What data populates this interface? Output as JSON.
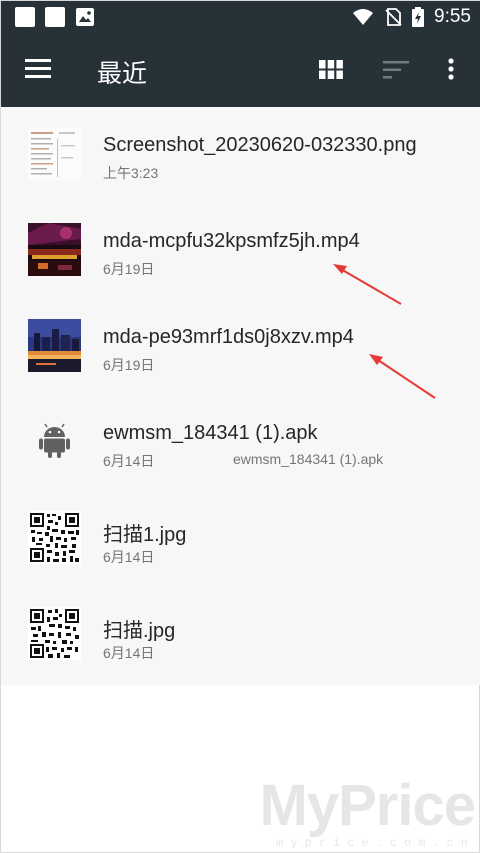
{
  "status_bar": {
    "time": "9:55"
  },
  "toolbar": {
    "title": "最近"
  },
  "files": [
    {
      "name": "Screenshot_20230620-032330.png",
      "date": "上午3:23",
      "extra": "",
      "thumb": "screenshot"
    },
    {
      "name": "mda-mcpfu32kpsmfz5jh.mp4",
      "date": "6月19日",
      "extra": "",
      "thumb": "video-stage"
    },
    {
      "name": "mda-pe93mrf1ds0j8xzv.mp4",
      "date": "6月19日",
      "extra": "",
      "thumb": "video-city"
    },
    {
      "name": "ewmsm_184341 (1).apk",
      "date": "6月14日",
      "extra": "ewmsm_184341 (1).apk",
      "thumb": "android"
    },
    {
      "name": "扫描1.jpg",
      "date": "6月14日",
      "extra": "",
      "thumb": "qr"
    },
    {
      "name": "扫描.jpg",
      "date": "6月14日",
      "extra": "",
      "thumb": "qr"
    }
  ],
  "watermark": {
    "brand": "MyPrice",
    "domain": "myprice.com.cn"
  },
  "colors": {
    "toolbar": "#263238",
    "list_background": "#f7f7f7",
    "annotation_arrow": "#e53935"
  }
}
